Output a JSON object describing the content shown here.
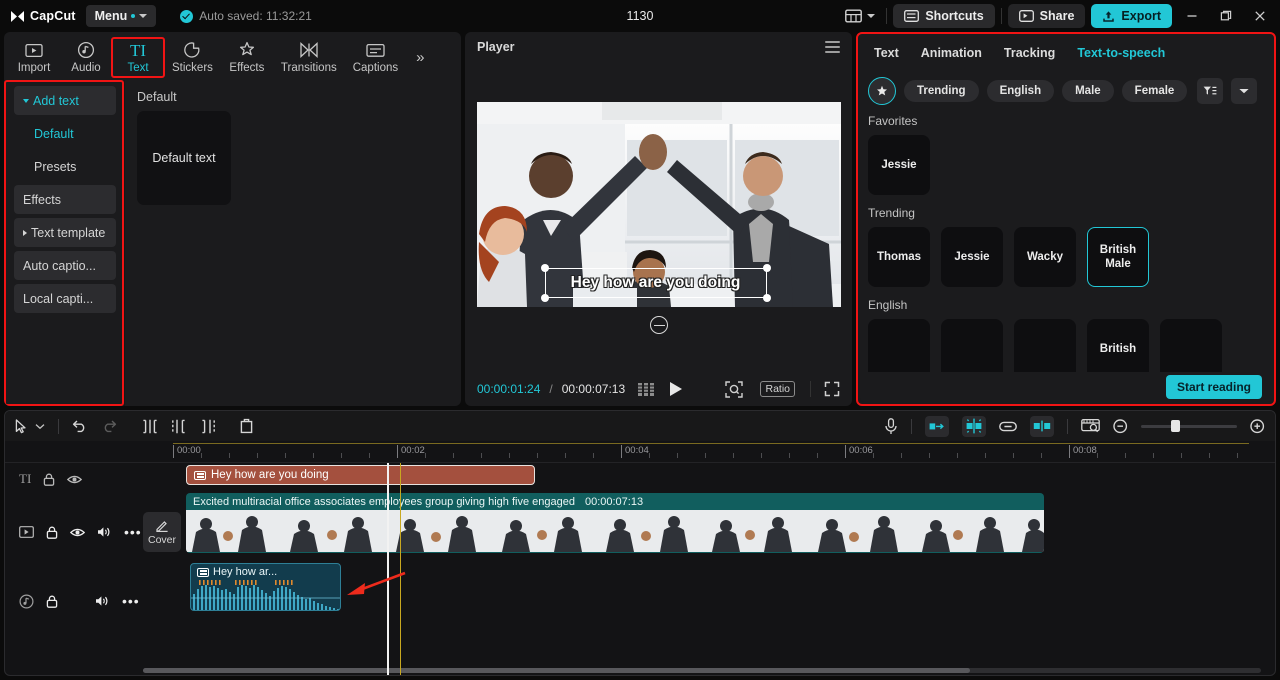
{
  "titlebar": {
    "brand": "CapCut",
    "menu_label": "Menu",
    "autosave": "Auto saved: 11:32:21",
    "project_title": "1130",
    "shortcuts_label": "Shortcuts",
    "share_label": "Share",
    "export_label": "Export",
    "minimize": "—",
    "maximize": "❐",
    "close": "✕"
  },
  "left_panel": {
    "tabs": [
      {
        "label": "Import",
        "icon": "import-icon",
        "active": false
      },
      {
        "label": "Audio",
        "icon": "audio-icon",
        "active": false
      },
      {
        "label": "Text",
        "icon": "text-icon",
        "active": true
      },
      {
        "label": "Stickers",
        "icon": "stickers-icon",
        "active": false
      },
      {
        "label": "Effects",
        "icon": "effects-icon",
        "active": false
      },
      {
        "label": "Transitions",
        "icon": "transitions-icon",
        "active": false
      },
      {
        "label": "Captions",
        "icon": "captions-icon",
        "active": false
      }
    ],
    "more_label": "»",
    "sidebar": [
      {
        "label": "Add text",
        "type": "group",
        "expanded": true,
        "accent": true
      },
      {
        "label": "Default",
        "type": "sub",
        "selected": true
      },
      {
        "label": "Presets",
        "type": "sub",
        "selected": false
      },
      {
        "label": "Effects",
        "type": "group",
        "expanded": null,
        "accent": false
      },
      {
        "label": "Text template",
        "type": "group",
        "expanded": false,
        "accent": false
      },
      {
        "label": "Auto captio...",
        "type": "group",
        "expanded": null,
        "accent": false
      },
      {
        "label": "Local capti...",
        "type": "group",
        "expanded": null,
        "accent": false
      }
    ],
    "preset_section_title": "Default",
    "preset_card_label": "Default text"
  },
  "player": {
    "title": "Player",
    "overlay_text": "Hey how are you doing",
    "current_time": "00:00:01:24",
    "time_separator": "/",
    "total_time": "00:00:07:13",
    "ratio_label": "Ratio"
  },
  "right_panel": {
    "tabs": [
      {
        "label": "Text",
        "active": false
      },
      {
        "label": "Animation",
        "active": false
      },
      {
        "label": "Tracking",
        "active": false
      },
      {
        "label": "Text-to-speech",
        "active": true
      }
    ],
    "chips": [
      {
        "label": "Trending"
      },
      {
        "label": "English"
      },
      {
        "label": "Male"
      },
      {
        "label": "Female"
      }
    ],
    "favorites_title": "Favorites",
    "favorites": [
      {
        "label": "Jessie",
        "selected": false
      }
    ],
    "trending_title": "Trending",
    "trending": [
      {
        "label": "Thomas",
        "selected": false
      },
      {
        "label": "Jessie",
        "selected": false
      },
      {
        "label": "Wacky",
        "selected": false
      },
      {
        "label": "British Male",
        "selected": true
      }
    ],
    "english_title": "English",
    "english": [
      {
        "label": "",
        "selected": false
      },
      {
        "label": "",
        "selected": false
      },
      {
        "label": "",
        "selected": false
      },
      {
        "label": "British",
        "selected": false
      },
      {
        "label": "",
        "selected": false
      }
    ],
    "start_reading_label": "Start reading"
  },
  "timeline": {
    "ruler_labels": [
      "00:00",
      "00:02",
      "00:04",
      "00:06",
      "00:08"
    ],
    "cover_label": "Cover",
    "zoom_out_icon": "zoom-out-icon",
    "zoom_in_icon": "zoom-in-icon",
    "tracks": {
      "text_clip_label": "Hey how are you doing",
      "video_clip_label": "Excited multiracial office associates employees group giving high five engaged",
      "video_clip_duration": "00:00:07:13",
      "audio_clip_label": "Hey how ar..."
    }
  },
  "colors": {
    "accent": "#22c7d6",
    "highlight_outline": "#f11414",
    "text_clip": "#a4503e",
    "video_clip": "#115e5e",
    "audio_clip": "#123c4d",
    "annotation_arrow": "#ee2b1c"
  }
}
